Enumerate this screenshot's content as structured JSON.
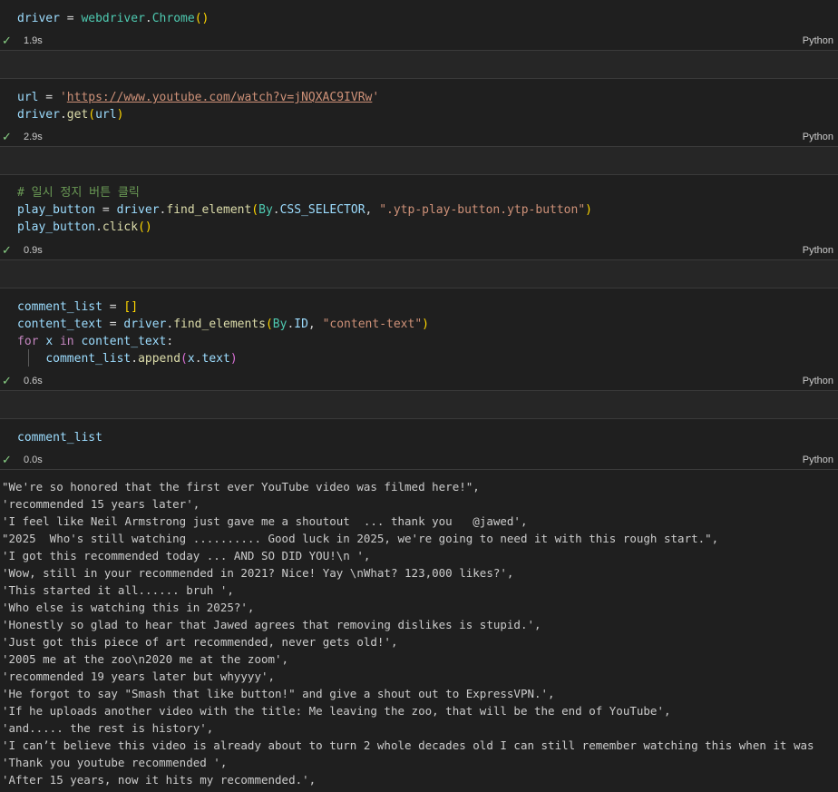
{
  "cells": [
    {
      "time": "1.9s",
      "language": "Python"
    },
    {
      "time": "2.9s",
      "language": "Python"
    },
    {
      "time": "0.9s",
      "language": "Python"
    },
    {
      "time": "0.6s",
      "language": "Python"
    },
    {
      "time": "0.0s",
      "language": "Python"
    }
  ],
  "code": {
    "c1": {
      "var": "driver",
      "eq": " = ",
      "mod": "webdriver",
      "dot": ".",
      "cls": "Chrome",
      "parens": "()"
    },
    "c2": {
      "var": "url",
      "eq": " = ",
      "q": "'",
      "url": "https://www.youtube.com/watch?v=jNQXAC9IVRw",
      "q2": "'",
      "var2": "driver",
      "dot": ".",
      "fn": "get",
      "po": "(",
      "arg": "url",
      "pc": ")"
    },
    "c3": {
      "comment": "# 일시 정지 버튼 클릭",
      "var": "play_button",
      "eq": " = ",
      "obj": "driver",
      "dot": ".",
      "fn": "find_element",
      "po": "(",
      "by": "By",
      "dot2": ".",
      "const": "CSS_SELECTOR",
      "comma": ", ",
      "str": "\".ytp-play-button.ytp-button\"",
      "pc": ")",
      "var2": "play_button",
      "dot3": ".",
      "fn2": "click",
      "parens": "()"
    },
    "c4": {
      "var": "comment_list",
      "eq": " = ",
      "brackets": "[]",
      "var2": "content_text",
      "eq2": " = ",
      "obj": "driver",
      "dot": ".",
      "fn": "find_elements",
      "po": "(",
      "by": "By",
      "dot2": ".",
      "const": "ID",
      "comma": ", ",
      "str": "\"content-text\"",
      "pc": ")",
      "kw_for": "for",
      "x": "x",
      "kw_in": "in",
      "iter": "content_text",
      "colon": ":",
      "indent": "    ",
      "list": "comment_list",
      "dot3": ".",
      "fn2": "append",
      "po2": "(",
      "x2": "x",
      "dot4": ".",
      "attr": "text",
      "pc2": ")"
    },
    "c5": {
      "var": "comment_list"
    }
  },
  "output_lines": [
    "\"We're so honored that the first ever YouTube video was filmed here!\",",
    "'recommended 15 years later',",
    "'I feel like Neil Armstrong just gave me a shoutout  ... thank you   @jawed',",
    "\"2025  Who's still watching .......... Good luck in 2025, we're going to need it with this rough start.\",",
    "'I got this recommended today ... AND SO DID YOU!\\n ',",
    "'Wow, still in your recommended in 2021? Nice! Yay \\nWhat? 123,000 likes?',",
    "'This started it all...... bruh ',",
    "'Who else is watching this in 2025?',",
    "'Honestly so glad to hear that Jawed agrees that removing dislikes is stupid.',",
    "'Just got this piece of art recommended, never gets old!',",
    "'2005 me at the zoo\\n2020 me at the zoom',",
    "'recommended 19 years later but whyyyy',",
    "'He forgot to say \"Smash that like button!\" and give a shout out to ExpressVPN.',",
    "'If he uploads another video with the title: Me leaving the zoo, that will be the end of YouTube',",
    "'and..... the rest is history',",
    "'I can’t believe this video is already about to turn 2 whole decades old I can still remember watching this when it was",
    "'Thank you youtube recommended ',",
    "'After 15 years, now it hits my recommended.',"
  ],
  "colors": {
    "background": "#1f1f1f",
    "success": "#89d185",
    "string": "#ce9178",
    "function": "#dcdcaa",
    "variable": "#9cdcfe",
    "class": "#4ec9b0",
    "keyword": "#c586c0",
    "comment": "#6a9955"
  }
}
